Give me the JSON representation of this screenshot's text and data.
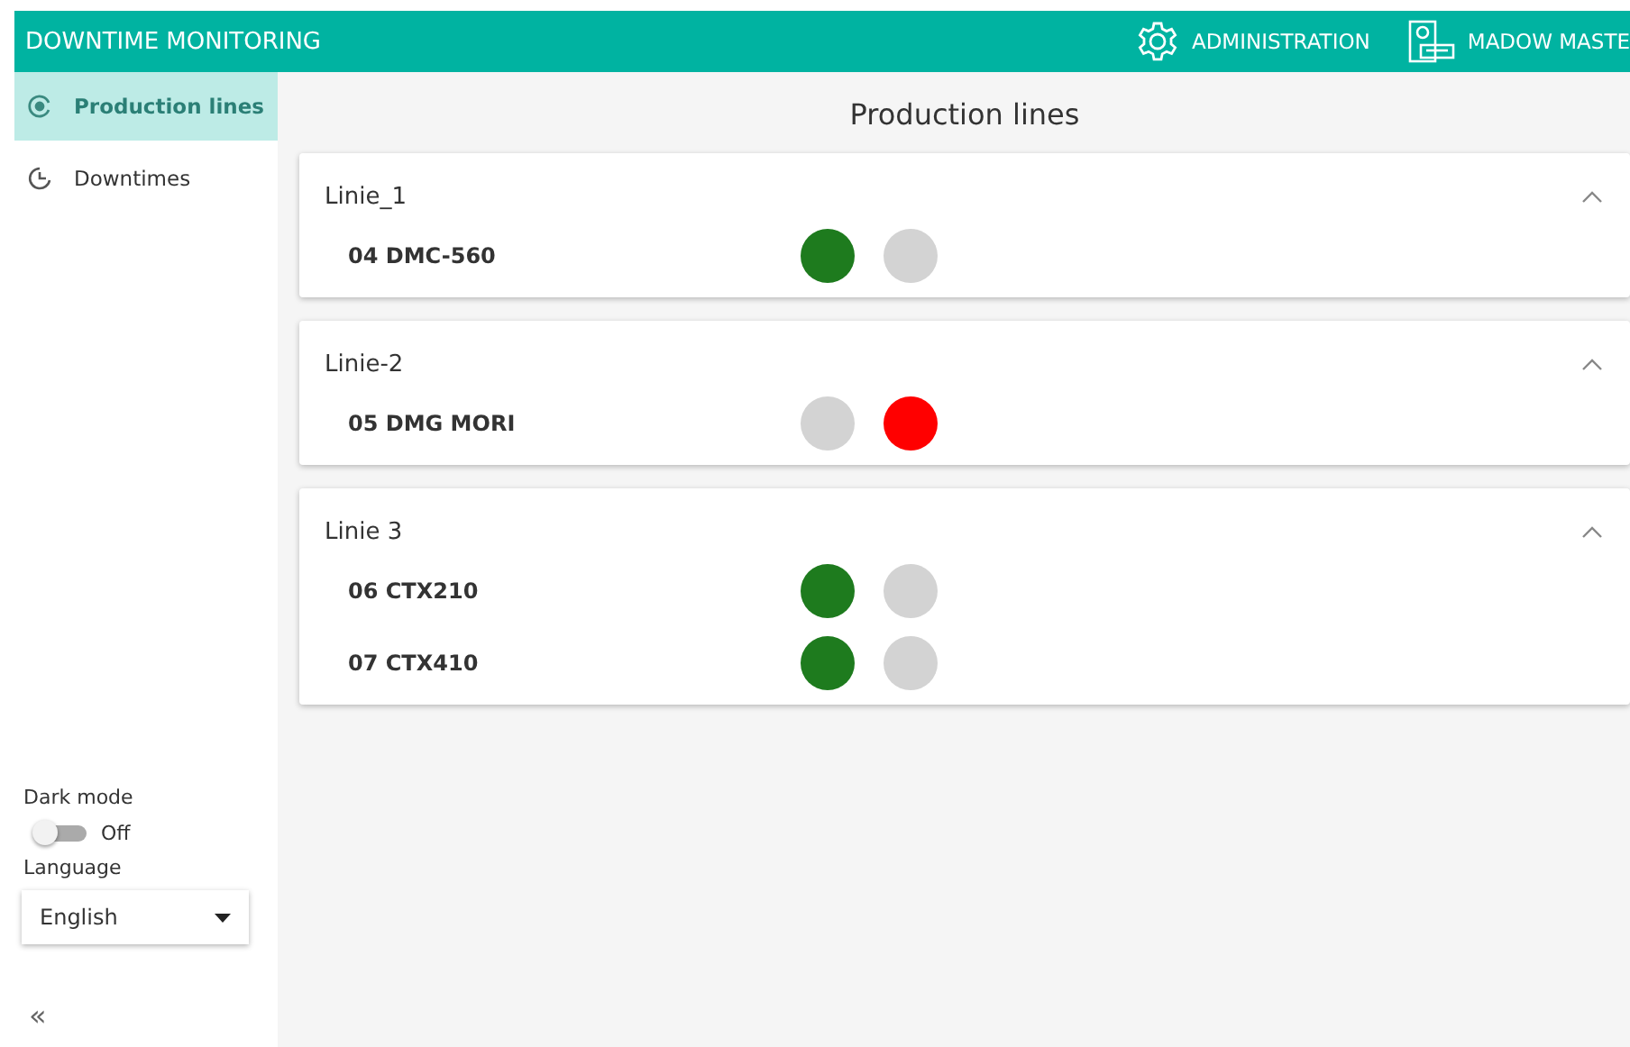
{
  "header": {
    "title": "DOWNTIME MONITORING",
    "actions": [
      {
        "kind": "gear",
        "label": "ADMINISTRATION"
      },
      {
        "kind": "machine",
        "label": "MADOW MASTE"
      }
    ]
  },
  "sidebar": {
    "items": [
      {
        "kind": "lines",
        "label": "Production lines",
        "selected": true
      },
      {
        "kind": "clock",
        "label": "Downtimes",
        "selected": false
      }
    ],
    "dark_mode": {
      "label": "Dark mode",
      "on": false,
      "state_text": "Off"
    },
    "language": {
      "label": "Language",
      "value": "English"
    },
    "collapse": "«"
  },
  "main": {
    "title": "Production lines",
    "lines": [
      {
        "name": "Linie_1",
        "expanded": true,
        "machines": [
          {
            "name": "04 DMC-560",
            "lamps": [
              {
                "color": "#1e7b1e"
              },
              {
                "color": "#d3d3d3"
              }
            ]
          }
        ]
      },
      {
        "name": "Linie-2",
        "expanded": true,
        "machines": [
          {
            "name": "05 DMG MORI",
            "lamps": [
              {
                "color": "#d3d3d3"
              },
              {
                "color": "#ff0000"
              }
            ]
          }
        ]
      },
      {
        "name": "Linie 3",
        "expanded": true,
        "machines": [
          {
            "name": "06 CTX210",
            "lamps": [
              {
                "color": "#1e7b1e"
              },
              {
                "color": "#d3d3d3"
              }
            ]
          },
          {
            "name": "07 CTX410",
            "lamps": [
              {
                "color": "#1e7b1e"
              },
              {
                "color": "#d3d3d3"
              }
            ]
          }
        ]
      }
    ]
  }
}
